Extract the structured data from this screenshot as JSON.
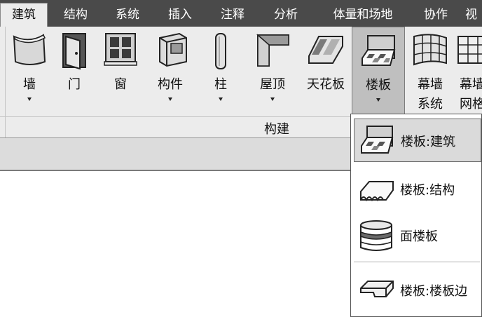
{
  "tabs": [
    "建筑",
    "结构",
    "系统",
    "插入",
    "注释",
    "分析",
    "体量和场地",
    "协作",
    "视"
  ],
  "active_tab": "建筑",
  "ribbon": {
    "buttons": [
      {
        "label": "墙",
        "icon": "wall-icon",
        "dropdown": true
      },
      {
        "label": "门",
        "icon": "door-icon",
        "dropdown": false
      },
      {
        "label": "窗",
        "icon": "window-icon",
        "dropdown": false
      },
      {
        "label": "构件",
        "icon": "component-icon",
        "dropdown": true
      },
      {
        "label": "柱",
        "icon": "column-icon",
        "dropdown": true
      },
      {
        "label": "屋顶",
        "icon": "roof-icon",
        "dropdown": true
      },
      {
        "label": "天花板",
        "icon": "ceiling-icon",
        "dropdown": false
      },
      {
        "label": "楼板",
        "icon": "floor-icon",
        "dropdown": true
      },
      {
        "label": "幕墙",
        "label2": "系统",
        "icon": "curtain-system-icon",
        "dropdown": false
      },
      {
        "label": "幕墙",
        "label2": "网格",
        "icon": "curtain-grid-icon",
        "dropdown": false
      }
    ],
    "panel_title": "构建"
  },
  "floor_dropdown": {
    "items": [
      {
        "label": "楼板:建筑",
        "icon": "floor-architectural-icon"
      },
      {
        "label": "楼板:结构",
        "icon": "floor-structural-icon"
      },
      {
        "label": "面楼板",
        "icon": "face-floor-icon"
      },
      {
        "label": "楼板:楼板边",
        "icon": "slab-edge-icon"
      }
    ]
  }
}
